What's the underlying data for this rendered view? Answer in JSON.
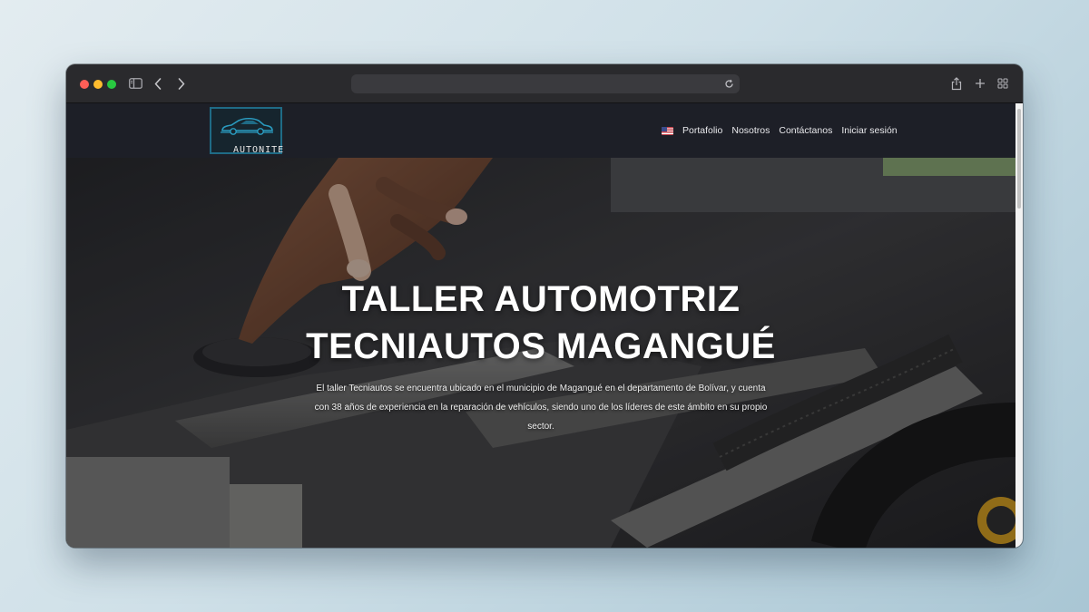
{
  "browser": {
    "address": "",
    "icons": [
      "sidebar-icon",
      "back-chevron-icon",
      "forward-chevron-icon",
      "reload-icon",
      "share-icon",
      "plus-icon",
      "tab-overview-icon"
    ]
  },
  "site": {
    "logo_text": "AUTONITE",
    "nav": {
      "language_flag": "us-flag-icon",
      "items": [
        "Portafolio",
        "Nosotros",
        "Contáctanos",
        "Iniciar sesión"
      ]
    },
    "hero": {
      "title_line1": "TALLER AUTOMOTRIZ",
      "title_line2": "TECNIAUTOS MAGANGUÉ",
      "description": "El taller Tecniautos se encuentra ubicado en el municipio de Magangué en el departamento de Bolívar, y cuenta con 38 años de experiencia en la reparación de vehículos, siendo uno de los líderes de este ámbito en su propio sector."
    }
  },
  "colors": {
    "header_bg": "#1d1f27",
    "logo_border": "#1f6b86",
    "traffic_red": "#fe5f57",
    "traffic_yellow": "#febc2e",
    "traffic_green": "#28c840"
  }
}
